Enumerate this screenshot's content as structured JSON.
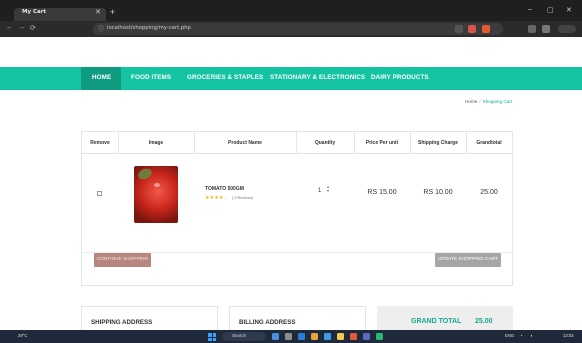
{
  "browser": {
    "tab_title": "My Cart",
    "tab_close": "✕",
    "new_tab": "+",
    "url": "localhost/shopping/my-cart.php",
    "back": "←",
    "forward": "→",
    "reload": "⟳",
    "minimize": "–",
    "maximize": "▢",
    "close": "✕"
  },
  "nav": {
    "items": [
      "HOME",
      "FOOD ITEMS",
      "GROCERIES & STAPLES",
      "STATIONARY & ELECTRONICS",
      "DAIRY PRODUCTS"
    ]
  },
  "breadcrumb": {
    "home": "Home",
    "separator": "/",
    "current": "Shopping Cart"
  },
  "cart": {
    "columns": [
      "Remove",
      "Image",
      "Product Name",
      "Quantity",
      "Price Per unit",
      "Shipping Charge",
      "Grandtotal"
    ],
    "rows": [
      {
        "product_name": "TOMATO 500GM",
        "rating_filled": "★★★★",
        "rating_empty": "☆",
        "reviews": "( 0 Reviews)",
        "quantity": "1",
        "price_per_unit": "RS 15.00",
        "shipping_charge": "RS 10.00",
        "grandtotal": "25.00"
      }
    ],
    "continue_button": "CONTINUE SHOPPING",
    "update_button": "UPDATE SHOPPING CART"
  },
  "bottom": {
    "shipping_address": "SHIPPING ADDRESS",
    "billing_address": "BILLING ADDRESS",
    "grand_total_label": "GRAND TOTAL",
    "grand_total_value": "25.00"
  },
  "taskbar": {
    "weather": "29°C",
    "search": "Search",
    "language": "ENG",
    "time": "13:03"
  },
  "colors": {
    "accent": "#14c3a2",
    "accent_dark": "#0e9b80",
    "accent_text": "#14a98d"
  }
}
